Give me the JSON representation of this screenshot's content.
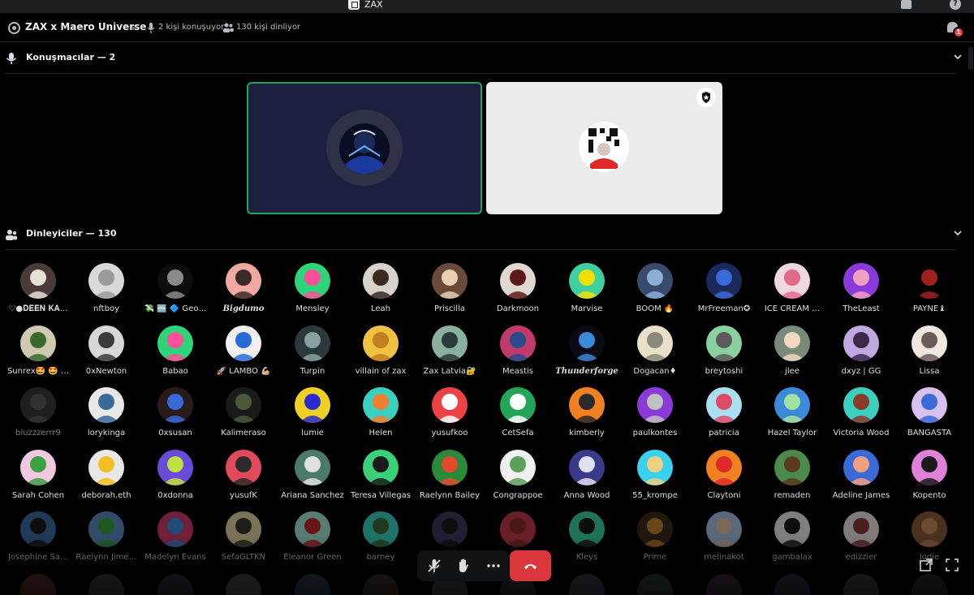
{
  "app": {
    "title": "ZAX"
  },
  "header": {
    "title": "ZAX x Maero Universe",
    "speaking": "2 kişi konuşuyor",
    "listening": "130 kişi dinliyor",
    "notification_count": "1"
  },
  "speakers_section": {
    "label": "Konuşmacılar — 2"
  },
  "listeners_section": {
    "label": "Dinleyiciler — 130"
  },
  "colors": {
    "accent_speaking": "#23a55a",
    "hangup": "#da373c",
    "badge": "#f23f43"
  },
  "listeners": [
    {
      "name": "♡●𝐃𝐄𝐄𝐍 𝐊𝐀…",
      "bg": "#4a3b3a",
      "fg": "#e8e0d8"
    },
    {
      "name": "nftboy",
      "bg": "#d9d9d9",
      "fg": "#9a9a9a"
    },
    {
      "name": "💸 🆒 🔷 Geo…",
      "bg": "#0d0d0d",
      "fg": "#8a8a8a"
    },
    {
      "name": "Bigdumo",
      "bg": "#f0a8a0",
      "fg": "#3a2a2a",
      "bold": true
    },
    {
      "name": "Mensley",
      "bg": "#2ed47a",
      "fg": "#ff4f9a"
    },
    {
      "name": "Leah",
      "bg": "#d8d2cc",
      "fg": "#3a2a22"
    },
    {
      "name": "Priscilla",
      "bg": "#6a4a3a",
      "fg": "#e8d0b0"
    },
    {
      "name": "Darkmoon",
      "bg": "#e0d8d0",
      "fg": "#5a1a1a"
    },
    {
      "name": "Marvise",
      "bg": "#3fd0a0",
      "fg": "#f0e000"
    },
    {
      "name": "BOOM 🔥",
      "bg": "#3a4a6a",
      "fg": "#8ab0d8"
    },
    {
      "name": "MrFreeman✪",
      "bg": "#1a2a5a",
      "fg": "#3a6ad8"
    },
    {
      "name": "ICE CREAM …",
      "bg": "#f0d8e0",
      "fg": "#e06a8a"
    },
    {
      "name": "TheLeast",
      "bg": "#8a3ad8",
      "fg": "#f0a0c0"
    },
    {
      "name": "PAYNE♝",
      "bg": "#000000",
      "fg": "#a02020"
    },
    {
      "name": "Sunrex🤩 🤩 …",
      "bg": "#d0c8b0",
      "fg": "#3a6a2a"
    },
    {
      "name": "0xNewton",
      "bg": "#d8d8d8",
      "fg": "#3a3a3a"
    },
    {
      "name": "Babao",
      "bg": "#2ed47a",
      "fg": "#ff4f9a"
    },
    {
      "name": "🚀 LAMBO 💪🏼",
      "bg": "#f0f0f0",
      "fg": "#2a6ad8"
    },
    {
      "name": "Turpin",
      "bg": "#2a3a3a",
      "fg": "#8aa0a0"
    },
    {
      "name": "villain of zax",
      "bg": "#f0c040",
      "fg": "#c08020"
    },
    {
      "name": "Zax Latvia🔐",
      "bg": "#8ab0a0",
      "fg": "#2a3a3a"
    },
    {
      "name": "Meastis",
      "bg": "#c03a6a",
      "fg": "#2a4a8a"
    },
    {
      "name": "Thunderforge",
      "bg": "#0a0a14",
      "fg": "#3a8ad8",
      "bold": true
    },
    {
      "name": "Dogacan♦",
      "bg": "#e8e0c8",
      "fg": "#8a8a7a"
    },
    {
      "name": "breytoshi",
      "bg": "#8ad0a0",
      "fg": "#5a5a5a"
    },
    {
      "name": "jlee",
      "bg": "#7a8a7a",
      "fg": "#f0d8c0"
    },
    {
      "name": "dxyz | GG",
      "bg": "#c0a8e0",
      "fg": "#3a2a4a"
    },
    {
      "name": "Lissa",
      "bg": "#f0e8e0",
      "fg": "#6a5a5a"
    },
    {
      "name": "bluzzzerrr9",
      "bg": "#3a3a3a",
      "fg": "#5a5a5a",
      "dim": true
    },
    {
      "name": "lorykinga",
      "bg": "#e8e8e8",
      "fg": "#3a6a9a"
    },
    {
      "name": "0xsusan",
      "bg": "#2a1a1a",
      "fg": "#3a6ad8"
    },
    {
      "name": "Kalimeraso",
      "bg": "#1a1a1a",
      "fg": "#4a5a3a"
    },
    {
      "name": "lumie",
      "bg": "#f0d020",
      "fg": "#2a2ad0"
    },
    {
      "name": "Helen",
      "bg": "#3ad0c0",
      "fg": "#f08030"
    },
    {
      "name": "yusufkoo",
      "bg": "#ed4245",
      "fg": "#ffffff"
    },
    {
      "name": "CetSefa",
      "bg": "#23a55a",
      "fg": "#ffffff"
    },
    {
      "name": "kimberly",
      "bg": "#f08020",
      "fg": "#2a2a2a"
    },
    {
      "name": "paulkontes",
      "bg": "#8a3ad8",
      "fg": "#c0c0c0"
    },
    {
      "name": "patricia",
      "bg": "#a8e0f0",
      "fg": "#e04a6a"
    },
    {
      "name": "Hazel Taylor",
      "bg": "#3a8ad8",
      "fg": "#a0e0a0"
    },
    {
      "name": "Victoria Wood",
      "bg": "#3ad0c0",
      "fg": "#8a3a2a"
    },
    {
      "name": "BANGASTA",
      "bg": "#d8c0f0",
      "fg": "#3a6ad8"
    },
    {
      "name": "Sarah Cohen",
      "bg": "#f0c8e0",
      "fg": "#3aa040"
    },
    {
      "name": "deborah.eth",
      "bg": "#e8e8e8",
      "fg": "#f0c020"
    },
    {
      "name": "0xdonna",
      "bg": "#6a4ad8",
      "fg": "#c0e040"
    },
    {
      "name": "yusufK",
      "bg": "#e04a5a",
      "fg": "#2a2a2a"
    },
    {
      "name": "Ariana Sanchez",
      "bg": "#4a7a6a",
      "fg": "#e0e0e0"
    },
    {
      "name": "Teresa Villegas",
      "bg": "#3ad07a",
      "fg": "#1a1a1a"
    },
    {
      "name": "Raelynn Bailey",
      "bg": "#2a8a3a",
      "fg": "#e04a2a"
    },
    {
      "name": "Congrappoe",
      "bg": "#f0f0f0",
      "fg": "#5aa05a"
    },
    {
      "name": "Anna Wood",
      "bg": "#3a3a8a",
      "fg": "#e0e0f0"
    },
    {
      "name": "55_krompe",
      "bg": "#3ad0f0",
      "fg": "#f0d080"
    },
    {
      "name": "Claytoni",
      "bg": "#f08020",
      "fg": "#e02a2a"
    },
    {
      "name": "remaden",
      "bg": "#4a8a4a",
      "fg": "#5a3a1a"
    },
    {
      "name": "Adeline James",
      "bg": "#3a6ad8",
      "fg": "#f0a080"
    },
    {
      "name": "Kopento",
      "bg": "#e080d8",
      "fg": "#1a1a1a"
    },
    {
      "name": "Josephine Sa…",
      "bg": "#3a6aa0",
      "fg": "#1a1a1a",
      "dim": true
    },
    {
      "name": "Raelynn Jime…",
      "bg": "#5a8ac0",
      "fg": "#3aa03a",
      "dim": true
    },
    {
      "name": "Madelyn Evans",
      "bg": "#d03a6a",
      "fg": "#3a8ad8",
      "dim": true
    },
    {
      "name": "SefaGLTKN",
      "bg": "#e0d0a0",
      "fg": "#3a3a2a",
      "dim": true
    },
    {
      "name": "Eleanor Green",
      "bg": "#a0e0d0",
      "fg": "#c02a2a",
      "dim": true
    },
    {
      "name": "barney",
      "bg": "#3ad0c0",
      "fg": "#3a6a3a",
      "dim": true
    },
    {
      "name": "",
      "bg": "#3a3a5a",
      "fg": "#1a1a1a",
      "dim": true
    },
    {
      "name": "",
      "bg": "#c03a4a",
      "fg": "#8a2a2a",
      "dim": true
    },
    {
      "name": "Kleys",
      "bg": "#3ad0a0",
      "fg": "#1a1a1a",
      "dim": true
    },
    {
      "name": "Prime",
      "bg": "#3a2a1a",
      "fg": "#c08030",
      "dim": true
    },
    {
      "name": "melinakot",
      "bg": "#a0c0e0",
      "fg": "#e0c0a0",
      "dim": true
    },
    {
      "name": "gambalax",
      "bg": "#e8e8e8",
      "fg": "#1a1a1a",
      "dim": true
    },
    {
      "name": "edizzier",
      "bg": "#e8e0e0",
      "fg": "#8a3a3a",
      "dim": true
    },
    {
      "name": "Jodie",
      "bg": "#8a5a3a",
      "fg": "#c08a5a",
      "dim": true
    }
  ],
  "controls": {
    "mute_label": "Mikrofon",
    "raise_hand_label": "El kaldır",
    "more_label": "Daha fazla",
    "leave_label": "Ayrıl"
  }
}
